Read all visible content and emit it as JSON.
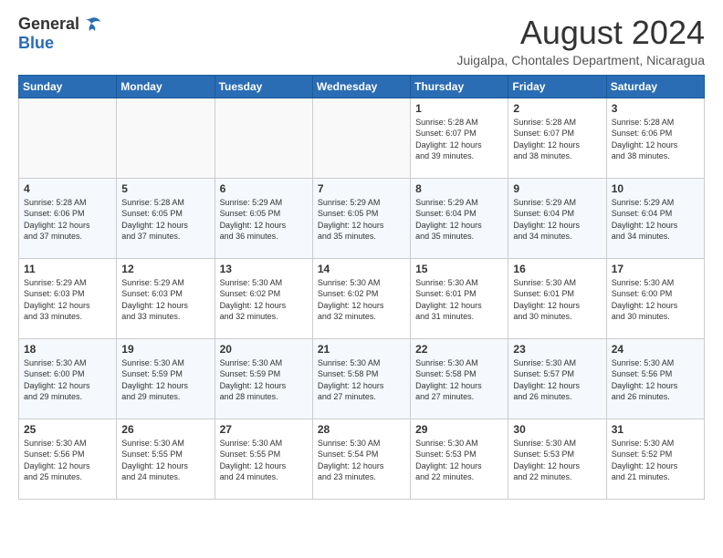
{
  "logo": {
    "general": "General",
    "blue": "Blue"
  },
  "title": "August 2024",
  "location": "Juigalpa, Chontales Department, Nicaragua",
  "days_of_week": [
    "Sunday",
    "Monday",
    "Tuesday",
    "Wednesday",
    "Thursday",
    "Friday",
    "Saturday"
  ],
  "weeks": [
    [
      {
        "day": "",
        "info": ""
      },
      {
        "day": "",
        "info": ""
      },
      {
        "day": "",
        "info": ""
      },
      {
        "day": "",
        "info": ""
      },
      {
        "day": "1",
        "info": "Sunrise: 5:28 AM\nSunset: 6:07 PM\nDaylight: 12 hours\nand 39 minutes."
      },
      {
        "day": "2",
        "info": "Sunrise: 5:28 AM\nSunset: 6:07 PM\nDaylight: 12 hours\nand 38 minutes."
      },
      {
        "day": "3",
        "info": "Sunrise: 5:28 AM\nSunset: 6:06 PM\nDaylight: 12 hours\nand 38 minutes."
      }
    ],
    [
      {
        "day": "4",
        "info": "Sunrise: 5:28 AM\nSunset: 6:06 PM\nDaylight: 12 hours\nand 37 minutes."
      },
      {
        "day": "5",
        "info": "Sunrise: 5:28 AM\nSunset: 6:05 PM\nDaylight: 12 hours\nand 37 minutes."
      },
      {
        "day": "6",
        "info": "Sunrise: 5:29 AM\nSunset: 6:05 PM\nDaylight: 12 hours\nand 36 minutes."
      },
      {
        "day": "7",
        "info": "Sunrise: 5:29 AM\nSunset: 6:05 PM\nDaylight: 12 hours\nand 35 minutes."
      },
      {
        "day": "8",
        "info": "Sunrise: 5:29 AM\nSunset: 6:04 PM\nDaylight: 12 hours\nand 35 minutes."
      },
      {
        "day": "9",
        "info": "Sunrise: 5:29 AM\nSunset: 6:04 PM\nDaylight: 12 hours\nand 34 minutes."
      },
      {
        "day": "10",
        "info": "Sunrise: 5:29 AM\nSunset: 6:04 PM\nDaylight: 12 hours\nand 34 minutes."
      }
    ],
    [
      {
        "day": "11",
        "info": "Sunrise: 5:29 AM\nSunset: 6:03 PM\nDaylight: 12 hours\nand 33 minutes."
      },
      {
        "day": "12",
        "info": "Sunrise: 5:29 AM\nSunset: 6:03 PM\nDaylight: 12 hours\nand 33 minutes."
      },
      {
        "day": "13",
        "info": "Sunrise: 5:30 AM\nSunset: 6:02 PM\nDaylight: 12 hours\nand 32 minutes."
      },
      {
        "day": "14",
        "info": "Sunrise: 5:30 AM\nSunset: 6:02 PM\nDaylight: 12 hours\nand 32 minutes."
      },
      {
        "day": "15",
        "info": "Sunrise: 5:30 AM\nSunset: 6:01 PM\nDaylight: 12 hours\nand 31 minutes."
      },
      {
        "day": "16",
        "info": "Sunrise: 5:30 AM\nSunset: 6:01 PM\nDaylight: 12 hours\nand 30 minutes."
      },
      {
        "day": "17",
        "info": "Sunrise: 5:30 AM\nSunset: 6:00 PM\nDaylight: 12 hours\nand 30 minutes."
      }
    ],
    [
      {
        "day": "18",
        "info": "Sunrise: 5:30 AM\nSunset: 6:00 PM\nDaylight: 12 hours\nand 29 minutes."
      },
      {
        "day": "19",
        "info": "Sunrise: 5:30 AM\nSunset: 5:59 PM\nDaylight: 12 hours\nand 29 minutes."
      },
      {
        "day": "20",
        "info": "Sunrise: 5:30 AM\nSunset: 5:59 PM\nDaylight: 12 hours\nand 28 minutes."
      },
      {
        "day": "21",
        "info": "Sunrise: 5:30 AM\nSunset: 5:58 PM\nDaylight: 12 hours\nand 27 minutes."
      },
      {
        "day": "22",
        "info": "Sunrise: 5:30 AM\nSunset: 5:58 PM\nDaylight: 12 hours\nand 27 minutes."
      },
      {
        "day": "23",
        "info": "Sunrise: 5:30 AM\nSunset: 5:57 PM\nDaylight: 12 hours\nand 26 minutes."
      },
      {
        "day": "24",
        "info": "Sunrise: 5:30 AM\nSunset: 5:56 PM\nDaylight: 12 hours\nand 26 minutes."
      }
    ],
    [
      {
        "day": "25",
        "info": "Sunrise: 5:30 AM\nSunset: 5:56 PM\nDaylight: 12 hours\nand 25 minutes."
      },
      {
        "day": "26",
        "info": "Sunrise: 5:30 AM\nSunset: 5:55 PM\nDaylight: 12 hours\nand 24 minutes."
      },
      {
        "day": "27",
        "info": "Sunrise: 5:30 AM\nSunset: 5:55 PM\nDaylight: 12 hours\nand 24 minutes."
      },
      {
        "day": "28",
        "info": "Sunrise: 5:30 AM\nSunset: 5:54 PM\nDaylight: 12 hours\nand 23 minutes."
      },
      {
        "day": "29",
        "info": "Sunrise: 5:30 AM\nSunset: 5:53 PM\nDaylight: 12 hours\nand 22 minutes."
      },
      {
        "day": "30",
        "info": "Sunrise: 5:30 AM\nSunset: 5:53 PM\nDaylight: 12 hours\nand 22 minutes."
      },
      {
        "day": "31",
        "info": "Sunrise: 5:30 AM\nSunset: 5:52 PM\nDaylight: 12 hours\nand 21 minutes."
      }
    ]
  ]
}
